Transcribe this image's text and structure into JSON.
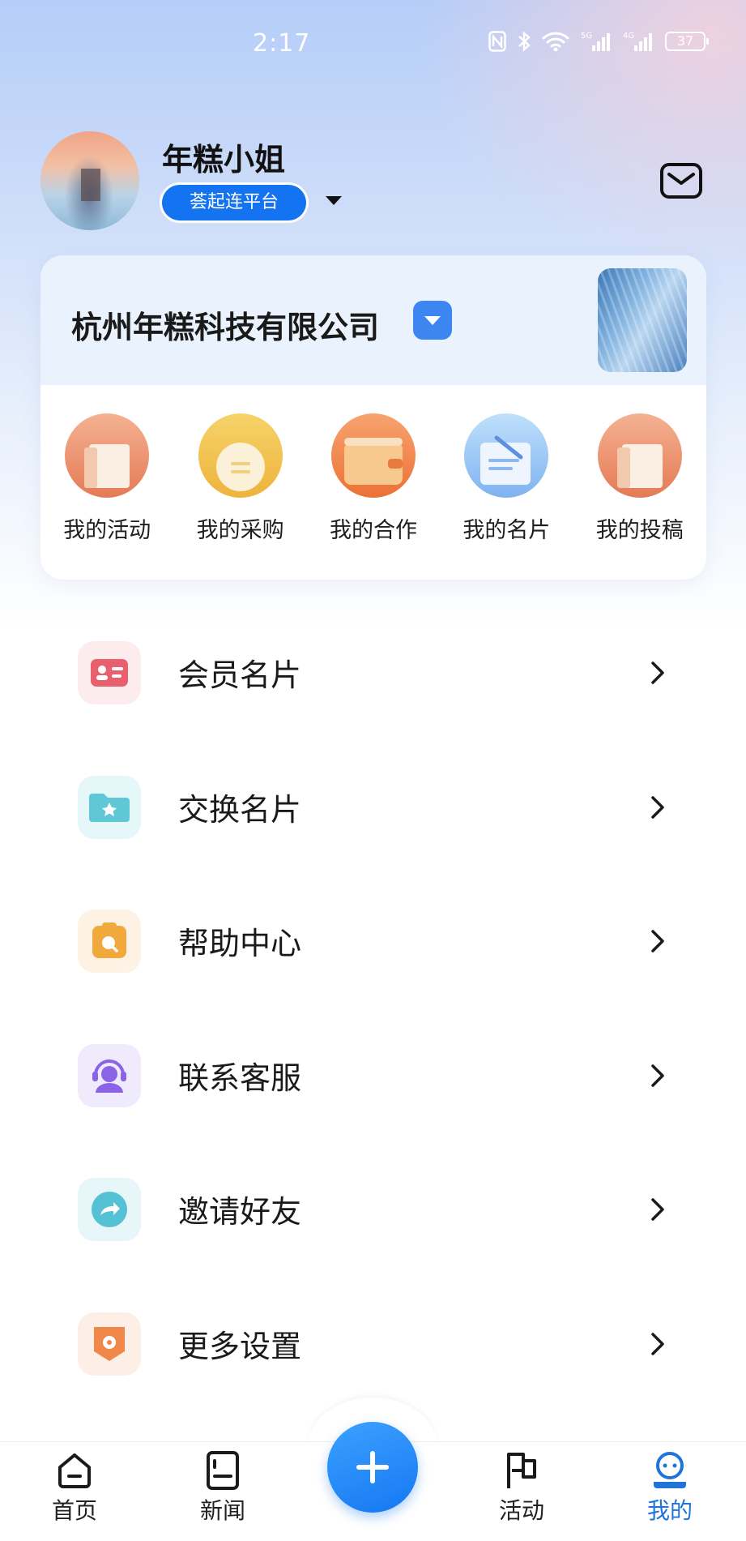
{
  "status_bar": {
    "time": "2:17",
    "battery": "37",
    "icons": [
      "nfc-icon",
      "bluetooth-icon",
      "wifi-icon",
      "signal-5g-icon",
      "signal-4g-icon",
      "battery-icon"
    ]
  },
  "profile": {
    "username": "年糕小姐",
    "platform": "荟起连平台"
  },
  "company": {
    "name": "杭州年糕科技有限公司"
  },
  "quick_actions": [
    {
      "label": "我的活动",
      "icon": "activity-icon"
    },
    {
      "label": "我的采购",
      "icon": "purchase-icon"
    },
    {
      "label": "我的合作",
      "icon": "cooperation-icon"
    },
    {
      "label": "我的名片",
      "icon": "business-card-icon"
    },
    {
      "label": "我的投稿",
      "icon": "submission-icon"
    }
  ],
  "menu": [
    {
      "label": "会员名片",
      "icon": "member-card-icon",
      "color": "#e8606e"
    },
    {
      "label": "交换名片",
      "icon": "exchange-card-icon",
      "color": "#5fc7d6"
    },
    {
      "label": "帮助中心",
      "icon": "help-center-icon",
      "color": "#f0a93a"
    },
    {
      "label": "联系客服",
      "icon": "customer-service-icon",
      "color": "#8b63e6"
    },
    {
      "label": "邀请好友",
      "icon": "invite-friends-icon",
      "color": "#54c2d4"
    },
    {
      "label": "更多设置",
      "icon": "more-settings-icon",
      "color": "#f0884a"
    }
  ],
  "tabs": [
    {
      "label": "首页",
      "icon": "home-icon"
    },
    {
      "label": "新闻",
      "icon": "news-icon"
    },
    {
      "label": "活动",
      "icon": "flag-icon"
    },
    {
      "label": "我的",
      "icon": "profile-icon",
      "active": true
    }
  ],
  "accent_color": "#1473f0"
}
